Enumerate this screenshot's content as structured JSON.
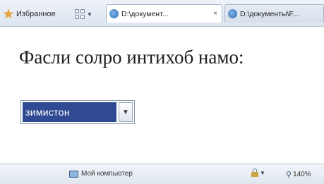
{
  "toolbar": {
    "favorites_label": "Избранное",
    "tabs": [
      {
        "label": "D:\\документ...",
        "close": "×"
      },
      {
        "label": "D:\\документы\\F..."
      }
    ]
  },
  "main": {
    "heading": "Фасли солро интихоб намо:",
    "select": {
      "value": "зимистон"
    }
  },
  "statusbar": {
    "zone": "Мой компьютер",
    "zoom": "140%"
  },
  "colors": {
    "selection": "#2f4a93",
    "toolbar": "#dde5f0"
  }
}
